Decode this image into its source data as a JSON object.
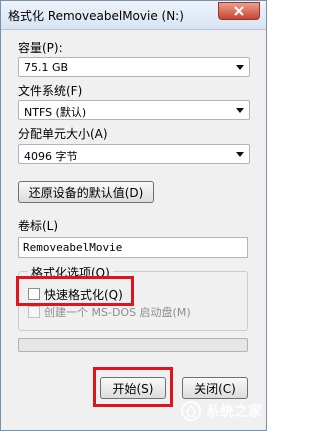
{
  "window": {
    "title": "格式化 RemoveabelMovie (N:)"
  },
  "capacity": {
    "label": "容量(P):",
    "value": "75.1 GB"
  },
  "filesystem": {
    "label": "文件系统(F)",
    "value": "NTFS (默认)"
  },
  "allocation": {
    "label": "分配单元大小(A)",
    "value": "4096 字节"
  },
  "restore_defaults_label": "还原设备的默认值(D)",
  "volume": {
    "label": "卷标(L)",
    "value": "RemoveabelMovie"
  },
  "format_options": {
    "title": "格式化选项(O)",
    "quick_format_label": "快速格式化(Q)",
    "quick_format_checked": false,
    "msdos_label": "创建一个 MS-DOS 启动盘(M)",
    "msdos_checked": false
  },
  "progress": {
    "value": 0
  },
  "buttons": {
    "start": "开始(S)",
    "close": "关闭(C)"
  },
  "watermark": {
    "text": "系统之家"
  },
  "colors": {
    "highlight": "#e0141e",
    "close_button": "#c9452f",
    "window_bg": "#f0f0f0"
  }
}
